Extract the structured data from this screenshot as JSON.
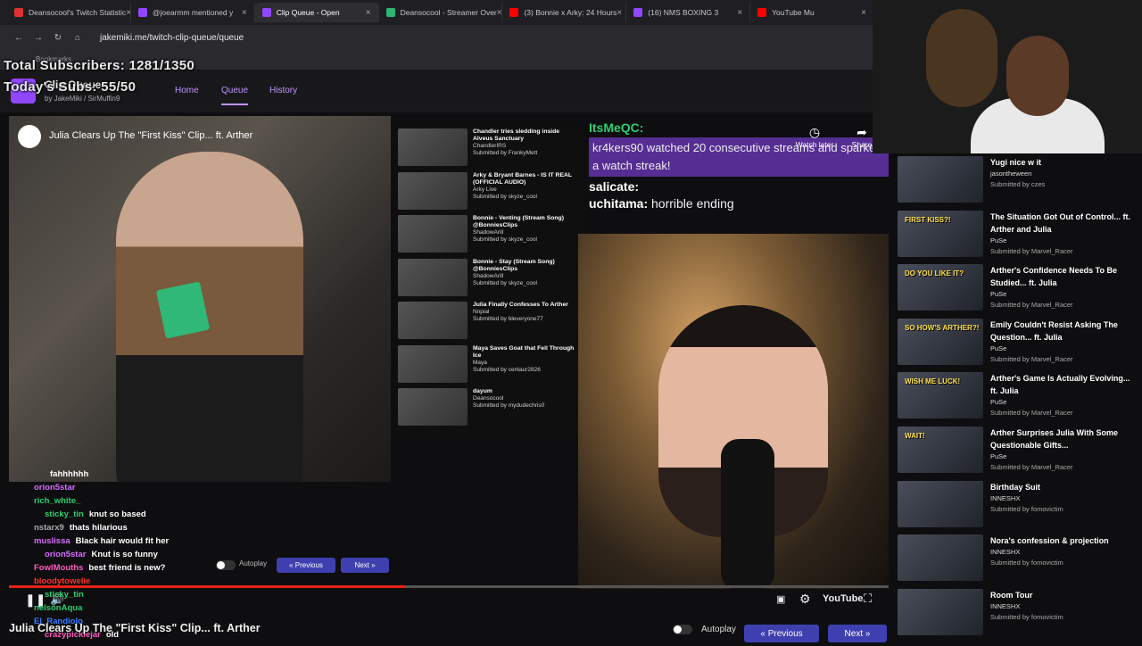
{
  "browser": {
    "tabs": [
      {
        "label": "Deansocool's Twitch Statistic",
        "color": "#e03131"
      },
      {
        "label": "@joearmm mentioned y",
        "color": "#9147ff"
      },
      {
        "label": "Clip Queue - Open",
        "color": "#9147ff",
        "active": true
      },
      {
        "label": "Deansocool - Streamer Over",
        "color": "#2bb673"
      },
      {
        "label": "(3) Bonnie x Arky: 24 Hours",
        "color": "#ff0000"
      },
      {
        "label": "(16) NMS BOXING 3",
        "color": "#9147ff"
      },
      {
        "label": "YouTube Mu",
        "color": "#ff0000"
      }
    ],
    "url": "jakemiki.me/twitch-clip-queue/queue",
    "bookmarks": "Bookmarks"
  },
  "overlay": {
    "total_subs": "Total Subscribers: 1281/1350",
    "today_subs": "Today's Subs: 55/50"
  },
  "app": {
    "title": "Clip Queue",
    "by": "by JakeMiki / SirMuffin9",
    "nav": {
      "home": "Home",
      "queue": "Queue",
      "history": "History"
    }
  },
  "player": {
    "title": "Julia Clears Up The \"First Kiss\" Clip... ft. Arther",
    "watch_later": "Watch later",
    "share": "Share",
    "autoplay": "Autoplay",
    "previous": "Previous",
    "next": "Next",
    "youtube": "YouTube",
    "progress": 0.45
  },
  "inner_queue": [
    {
      "title": "Chandler tries sledding inside Alveus Sanctuary",
      "channel": "ChandlerIRS",
      "by": "Submitted by FrankyMett"
    },
    {
      "title": "Arky & Bryant Barnes - IS IT REAL (OFFICIAL AUDIO)",
      "channel": "Arky Live",
      "by": "Submitted by skyze_cool"
    },
    {
      "title": "Bonnie - Venting (Stream Song) @BonniesClips",
      "channel": "ShadowArill",
      "by": "Submitted by skyze_cool"
    },
    {
      "title": "Bonnie - Stay (Stream Song) @BonniesClips",
      "channel": "ShadowArill",
      "by": "Submitted by skyze_cool"
    },
    {
      "title": "Julia Finally Confesses To Arther",
      "channel": "Nnpial",
      "by": "Submitted by bleveryone77"
    },
    {
      "title": "Maya Saves Goat that Fell Through Ice",
      "channel": "Maya",
      "by": "Submitted by centaur2826"
    },
    {
      "title": "dayum",
      "channel": "Deansocool",
      "by": "Submitted by mydudechris0"
    }
  ],
  "chat_top": [
    {
      "user": "ItsMeQC:",
      "msg": "",
      "color": "#2ecc71"
    },
    {
      "notice": "kr4kers90 watched 20 consecutive streams and sparked a watch streak!"
    },
    {
      "user": "salicate:",
      "msg": "",
      "color": "#ffffff"
    },
    {
      "user": "uchitama:",
      "msg": "horrible ending",
      "color": "#ffffff"
    }
  ],
  "chat_left": [
    {
      "user": "",
      "msg": "fahhhhhh",
      "color": "#3a3aff"
    },
    {
      "user": "orion5star",
      "msg": "",
      "color": "#d96bff"
    },
    {
      "user": "rich_white_",
      "msg": "",
      "color": "#2ecc71"
    },
    {
      "user": "sticky_tin",
      "msg": "knut so based",
      "color": "#2ecc71"
    },
    {
      "user": "nstarx9",
      "msg": "thats hilarious",
      "color": "#aaaaaa"
    },
    {
      "user": "muslissa",
      "msg": "Black hair would fit her",
      "color": "#d96bff"
    },
    {
      "user": "orion5star",
      "msg": "Knut is so funny",
      "color": "#d96bff"
    },
    {
      "user": "FowlMouths",
      "msg": "best friend is new?",
      "color": "#ff5bbf"
    },
    {
      "user": "bloodytowelie",
      "msg": "",
      "color": "#ff3030"
    },
    {
      "user": "sticky_tin",
      "msg": "",
      "color": "#2ecc71"
    },
    {
      "user": "nelsonAqua",
      "msg": "",
      "color": "#2ecc71"
    },
    {
      "user": "El_Randiolo",
      "msg": "",
      "color": "#3a7bff"
    },
    {
      "user": "crazypicklejar",
      "msg": "old",
      "color": "#ff5bbf"
    }
  ],
  "bottom": {
    "title": "Julia Clears Up The \"First Kiss\" Clip... ft. Arther",
    "autoplay": "Autoplay",
    "previous": "Previous",
    "next": "Next"
  },
  "sidebar": [
    {
      "title": "Yugi nice w it",
      "channel": "jasontheween",
      "by": "Submitted by czes",
      "tag": ""
    },
    {
      "title": "The Situation Got Out of Control... ft. Arther and Julia",
      "channel": "PuSe",
      "by": "Submitted by Marvel_Racer",
      "tag": "FIRST KISS?!"
    },
    {
      "title": "Arther's Confidence Needs To Be Studied... ft. Julia",
      "channel": "PuSe",
      "by": "Submitted by Marvel_Racer",
      "tag": "DO YOU LIKE IT?"
    },
    {
      "title": "Emily Couldn't Resist Asking The Question... ft. Julia",
      "channel": "PuSe",
      "by": "Submitted by Marvel_Racer",
      "tag": "SO HOW'S ARTHER?!"
    },
    {
      "title": "Arther's Game Is Actually Evolving... ft. Julia",
      "channel": "PuSe",
      "by": "Submitted by Marvel_Racer",
      "tag": "WISH ME LUCK!"
    },
    {
      "title": "Arther Surprises Julia With Some Questionable Gifts...",
      "channel": "PuSe",
      "by": "Submitted by Marvel_Racer",
      "tag": "WAIT!"
    },
    {
      "title": "Birthday Suit",
      "channel": "INNESHX",
      "by": "Submitted by fomovictim",
      "tag": ""
    },
    {
      "title": "Nora's confession & projection",
      "channel": "INNESHX",
      "by": "Submitted by fomovictim",
      "tag": ""
    },
    {
      "title": "Room Tour",
      "channel": "INNESHX",
      "by": "Submitted by fomovictim",
      "tag": ""
    }
  ]
}
